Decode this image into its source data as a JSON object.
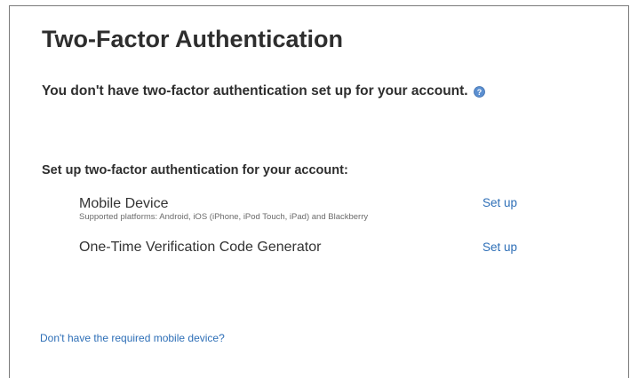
{
  "page": {
    "title": "Two-Factor Authentication",
    "status_message": "You don't have two-factor authentication set up for your account.",
    "help_icon": "question-circle-icon",
    "setup_heading": "Set up two-factor authentication for your account:",
    "methods": [
      {
        "name": "Mobile Device",
        "description": "Supported platforms: Android, iOS (iPhone, iPod Touch, iPad) and Blackberry",
        "action_label": "Set up"
      },
      {
        "name": "One-Time Verification Code Generator",
        "description": "",
        "action_label": "Set up"
      }
    ],
    "footer_link": "Don't have the required mobile device?"
  },
  "colors": {
    "text": "#2e2e2e",
    "link": "#2e6fb7",
    "border": "#7a7a7a",
    "help_icon": "#5b8fd0"
  }
}
